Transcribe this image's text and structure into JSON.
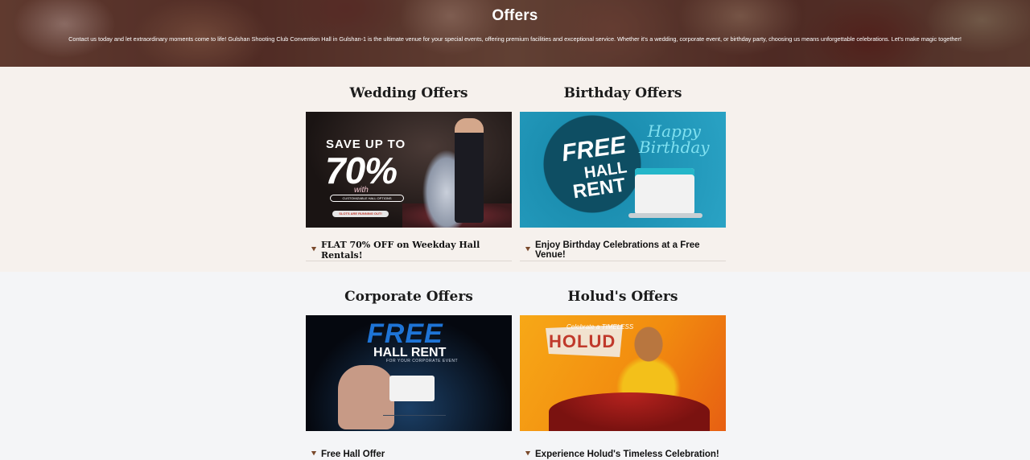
{
  "hero": {
    "title": "Offers",
    "description": "Contact us today and let extraordinary moments come to life! Gulshan Shooting Club Convention Hall in Gulshan-1 is the ultimate venue for your special events, offering premium facilities and exceptional service. Whether it's a wedding, corporate event, or birthday party, choosing us means unforgettable celebrations. Let's make magic together!"
  },
  "offers": [
    {
      "title": "Wedding Offers",
      "caption": "FLAT 70% OFF on Weekday Hall Rentals!",
      "image": {
        "line1": "SAVE UP TO",
        "line2": "70%",
        "line3": "with",
        "pill1": "CUSTOMIZABLE HALL OPTIONS",
        "pill2": "SLOTS ARE RUNNING OUT!"
      }
    },
    {
      "title": "Birthday Offers",
      "caption": "Enjoy Birthday Celebrations at a Free Venue!",
      "image": {
        "free": "FREE",
        "hall": "HALL",
        "rent": "RENT",
        "happy": "Happy",
        "birthday": "Birthday"
      }
    },
    {
      "title": "Corporate Offers",
      "caption": "Free Hall Offer",
      "image": {
        "free": "FREE",
        "hall": "HALL RENT",
        "sub": "FOR YOUR CORPORATE EVENT"
      }
    },
    {
      "title": "Holud's Offers",
      "caption": "Experience Holud's Timeless Celebration!",
      "image": {
        "celebrate": "Celebrate a",
        "timeless": "TIMELESS",
        "holud": "HOLUD"
      }
    }
  ],
  "icons": {
    "caption_chevron": "chevron-double-down-icon"
  },
  "colors": {
    "section1_bg": "#f6f1ed",
    "section2_bg": "#f4f5f7",
    "chevron": "#7a4a2c"
  }
}
